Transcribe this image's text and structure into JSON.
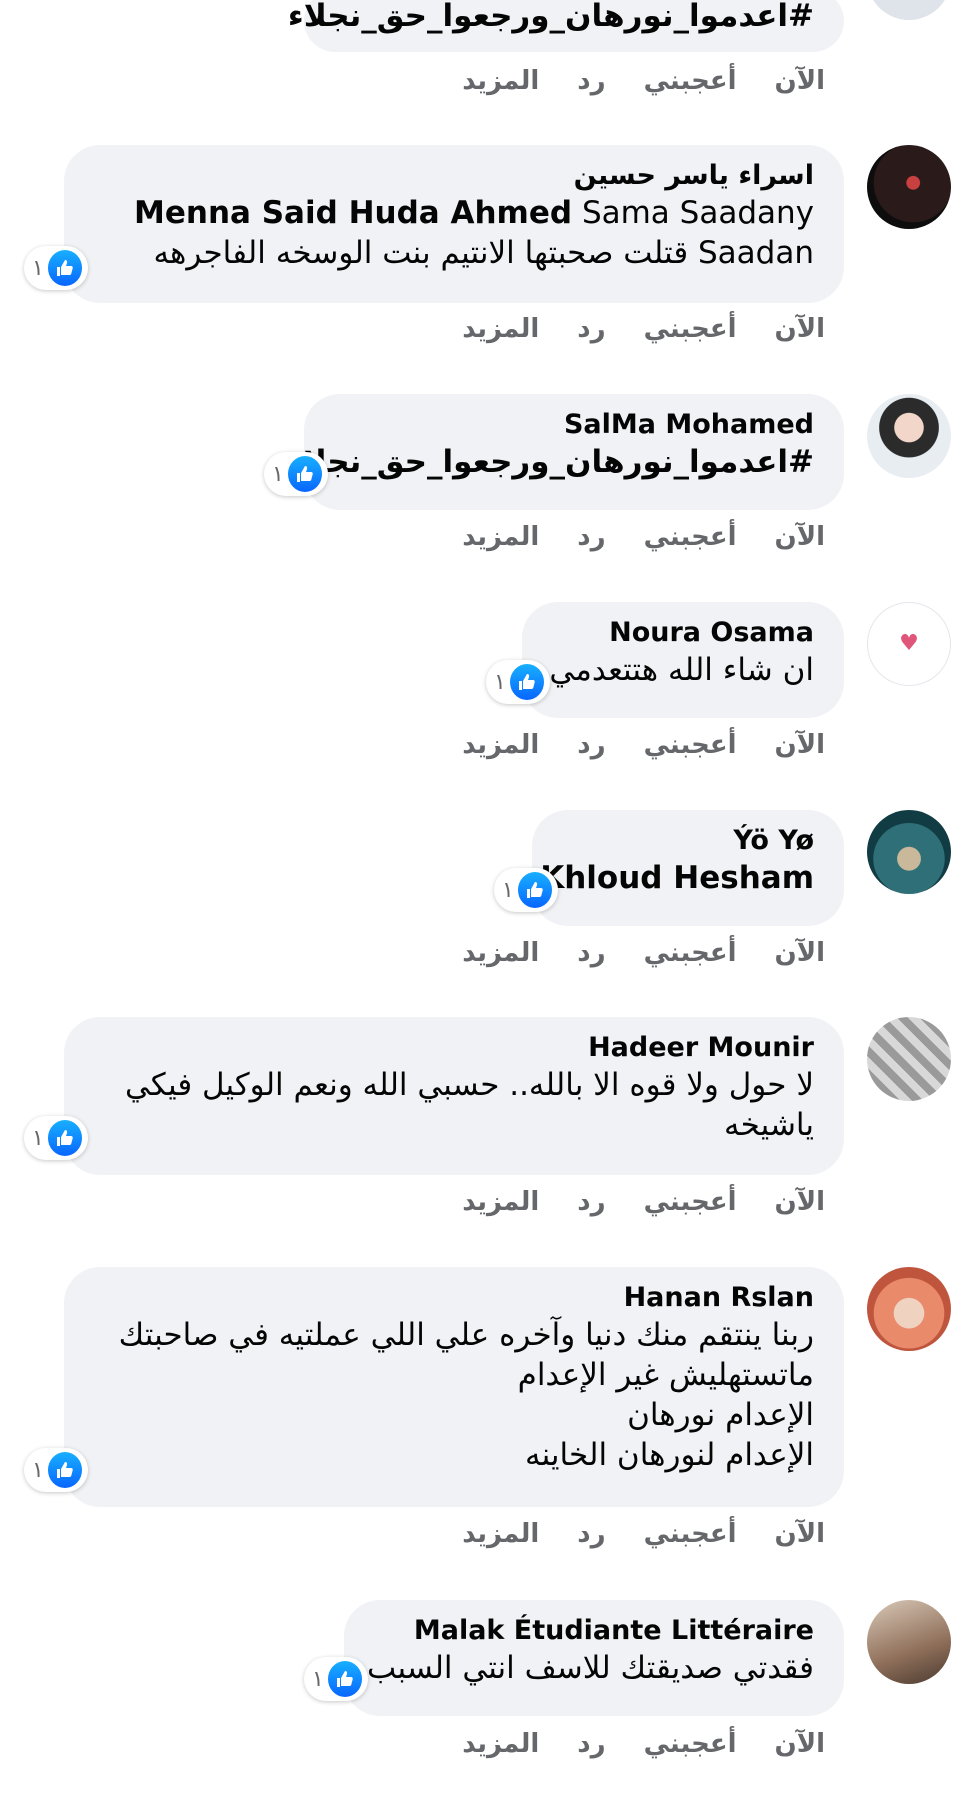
{
  "actions": {
    "time": "الآن",
    "like": "أعجبني",
    "reply": "رد",
    "more": "المزيد"
  },
  "comments": [
    {
      "author": "",
      "lines": [
        "#اعدموا_نورهان_ورجعوا_حق_نجلاء"
      ],
      "likes": ""
    },
    {
      "author": "اسراء ياسر حسين",
      "lines": [
        "Menna Said Huda Ahmed",
        "Sama Saadany",
        "Saadan قتلت صحبتها الانتيم بنت الوسخه الفاجرهه"
      ],
      "likes": "١"
    },
    {
      "author": "SalMa Mohamed",
      "lines": [
        "#اعدموا_نورهان_ورجعوا_حق_نجلاء"
      ],
      "likes": "١"
    },
    {
      "author": "Noura Osama",
      "lines": [
        "ان شاء الله هتتعدمي"
      ],
      "likes": "١"
    },
    {
      "author": "Ýö Yø",
      "lines": [
        "Khloud Hesham"
      ],
      "likes": "١"
    },
    {
      "author": "Hadeer Mounir",
      "lines": [
        "لا حول ولا قوه الا بالله.. حسبي الله ونعم الوكيل فيكي",
        "ياشيخه"
      ],
      "likes": "١"
    },
    {
      "author": "Hanan Rslan",
      "lines": [
        "ربنا ينتقم منك دنيا وآخره علي اللي عملتيه في صاحبتك",
        "ماتستهليش غير الإعدام",
        "الإعدام نورهان",
        "الإعدام لنورهان الخاينه"
      ],
      "likes": "١"
    },
    {
      "author": "Malak Étudiante Littéraire",
      "lines": [
        "فقدتي صديقتك للاسف انتي السبب"
      ],
      "likes": "١"
    }
  ],
  "avatar_icons": [
    "avatar-photo-icon",
    "avatar-dark-photo-icon",
    "avatar-woman-photo-icon",
    "avatar-heart-logo-icon",
    "avatar-cat-photo-icon",
    "avatar-collage-icon",
    "avatar-hijab-photo-icon",
    "avatar-room-photo-icon"
  ],
  "colors": {
    "bubble": "#f0f2f5",
    "text": "#050505",
    "meta": "#65676b",
    "like": "#0866ff"
  }
}
